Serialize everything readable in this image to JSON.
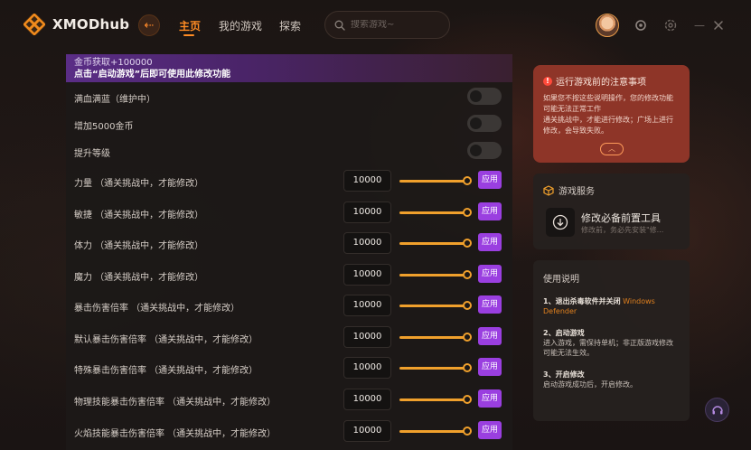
{
  "app": {
    "name": "XMODhub"
  },
  "nav": {
    "home": "主页",
    "my_games": "我的游戏",
    "explore": "探索"
  },
  "search": {
    "placeholder": "搜索游戏~"
  },
  "banner": {
    "line1": "金币获取+100000",
    "line2": "点击“启动游戏”后即可使用此修改功能"
  },
  "toggles": [
    {
      "label": "满血满蓝（维护中）",
      "on": false
    },
    {
      "label": "增加5000金币",
      "on": false
    },
    {
      "label": "提升等级",
      "on": false
    }
  ],
  "apply_label": "应用",
  "sliders": [
    {
      "label": "力量 （通关挑战中，才能修改）",
      "value": "10000"
    },
    {
      "label": "敏捷 （通关挑战中，才能修改）",
      "value": "10000"
    },
    {
      "label": "体力 （通关挑战中，才能修改）",
      "value": "10000"
    },
    {
      "label": "魔力 （通关挑战中，才能修改）",
      "value": "10000"
    },
    {
      "label": "暴击伤害倍率 （通关挑战中，才能修改）",
      "value": "10000"
    },
    {
      "label": "默认暴击伤害倍率 （通关挑战中，才能修改）",
      "value": "10000"
    },
    {
      "label": "特殊暴击伤害倍率 （通关挑战中，才能修改）",
      "value": "10000"
    },
    {
      "label": "物理技能暴击伤害倍率 （通关挑战中，才能修改）",
      "value": "10000"
    },
    {
      "label": "火焰技能暴击伤害倍率 （通关挑战中，才能修改）",
      "value": "10000"
    }
  ],
  "notice": {
    "title": "运行游戏前的注意事项",
    "body1": "如果您不按这些说明操作，您的修改功能可能无法正常工作",
    "body2": "通关挑战中，才能进行修改；广场上进行修改，会导致失败。",
    "expand_icon": "chevron-up-icon"
  },
  "service": {
    "title": "游戏服务",
    "item_name": "修改必备前置工具",
    "item_desc": "修改前，务必先安装\"修..."
  },
  "guide": {
    "title": "使用说明",
    "step1_title": "1、退出杀毒软件并关闭",
    "step1_highlight": "Windows Defender",
    "step2_title": "2、启动游戏",
    "step2_body": "进入游戏，需保持单机；非正版游戏修改可能无法生效。",
    "step3_title": "3、开启修改",
    "step3_body": "启动游戏成功后，开启修改。"
  },
  "colors": {
    "accent": "#ff8c24",
    "apply": "#9a3fe0",
    "notice_bg": "#8e3528",
    "slider": "#f0a02c"
  }
}
